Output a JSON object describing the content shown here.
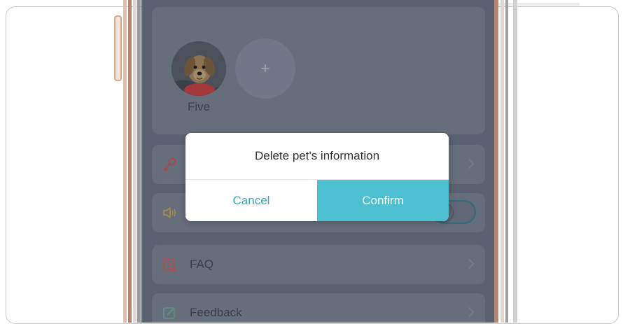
{
  "pets": {
    "items": [
      {
        "name": "Five"
      }
    ],
    "add_label": "+"
  },
  "menu": {
    "items": [
      {
        "label": "",
        "icon": "key-icon"
      },
      {
        "label": "",
        "icon": "speaker-icon",
        "toggle": true
      },
      {
        "label": "FAQ",
        "icon": "faq-icon"
      },
      {
        "label": "Feedback",
        "icon": "feedback-icon"
      }
    ]
  },
  "dialog": {
    "title": "Delete pet's information",
    "cancel_label": "Cancel",
    "confirm_label": "Confirm"
  },
  "colors": {
    "accent": "#4cbfd1",
    "cancel_text": "#34a7bd",
    "overlay": "#5a6170",
    "key_icon": "#a64a4a",
    "speaker_icon": "#b08a43",
    "faq_icon": "#b04c4c",
    "feedback_icon": "#5b8f7d"
  }
}
